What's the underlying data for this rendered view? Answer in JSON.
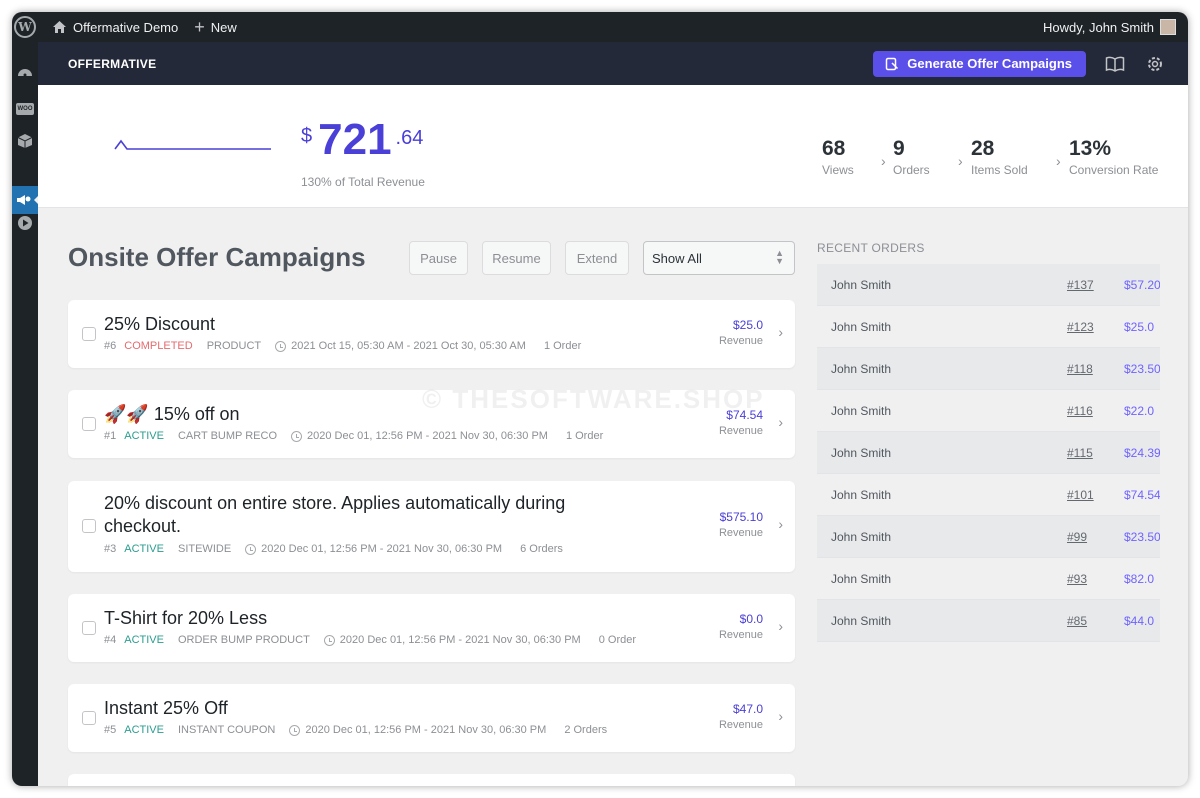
{
  "adminbar": {
    "site_name": "Offermative Demo",
    "new_label": "New",
    "greeting": "Howdy, John Smith"
  },
  "header": {
    "brand": "OFFERMATIVE",
    "generate_label": "Generate Offer Campaigns"
  },
  "stats": {
    "currency": "$",
    "revenue_int": "721",
    "revenue_dec": ".64",
    "revenue_note": "130% of Total Revenue",
    "metrics": [
      {
        "value": "68",
        "label": "Views"
      },
      {
        "value": "9",
        "label": "Orders"
      },
      {
        "value": "28",
        "label": "Items Sold"
      },
      {
        "value": "13%",
        "label": "Conversion Rate"
      }
    ]
  },
  "campaigns": {
    "title": "Onsite Offer Campaigns",
    "actions": {
      "pause": "Pause",
      "resume": "Resume",
      "extend": "Extend"
    },
    "filter": "Show All",
    "items": [
      {
        "title": "25% Discount",
        "id": "#6",
        "status": "COMPLETED",
        "type": "PRODUCT",
        "dates": "2021 Oct 15, 05:30 AM - 2021 Oct 30, 05:30 AM",
        "orders": "1 Order",
        "revenue": "$25.0",
        "revenue_label": "Revenue"
      },
      {
        "title": "🚀🚀 15% off on",
        "id": "#1",
        "status": "ACTIVE",
        "type": "CART BUMP RECO",
        "dates": "2020 Dec 01, 12:56 PM - 2021 Nov 30, 06:30 PM",
        "orders": "1 Order",
        "revenue": "$74.54",
        "revenue_label": "Revenue"
      },
      {
        "title": "20% discount on entire store. Applies automatically during checkout.",
        "id": "#3",
        "status": "ACTIVE",
        "type": "SITEWIDE",
        "dates": "2020 Dec 01, 12:56 PM - 2021 Nov 30, 06:30 PM",
        "orders": "6 Orders",
        "revenue": "$575.10",
        "revenue_label": "Revenue"
      },
      {
        "title": "T-Shirt for 20% Less",
        "id": "#4",
        "status": "ACTIVE",
        "type": "ORDER BUMP PRODUCT",
        "dates": "2020 Dec 01, 12:56 PM - 2021 Nov 30, 06:30 PM",
        "orders": "0 Order",
        "revenue": "$0.0",
        "revenue_label": "Revenue"
      },
      {
        "title": "Instant 25% Off",
        "id": "#5",
        "status": "ACTIVE",
        "type": "INSTANT COUPON",
        "dates": "2020 Dec 01, 12:56 PM - 2021 Nov 30, 06:30 PM",
        "orders": "2 Orders",
        "revenue": "$47.0",
        "revenue_label": "Revenue"
      }
    ]
  },
  "recent_orders": {
    "title": "RECENT ORDERS",
    "rows": [
      {
        "name": "John Smith",
        "id": "#137",
        "amount": "$57.20"
      },
      {
        "name": "John Smith",
        "id": "#123",
        "amount": "$25.0"
      },
      {
        "name": "John Smith",
        "id": "#118",
        "amount": "$23.50"
      },
      {
        "name": "John Smith",
        "id": "#116",
        "amount": "$22.0"
      },
      {
        "name": "John Smith",
        "id": "#115",
        "amount": "$24.39"
      },
      {
        "name": "John Smith",
        "id": "#101",
        "amount": "$74.54"
      },
      {
        "name": "John Smith",
        "id": "#99",
        "amount": "$23.50"
      },
      {
        "name": "John Smith",
        "id": "#93",
        "amount": "$82.0"
      },
      {
        "name": "John Smith",
        "id": "#85",
        "amount": "$44.0"
      }
    ]
  },
  "watermark": "© THESOFTWARE.SHOP",
  "colors": {
    "accent": "#5b4fe9",
    "active": "#2a9d8f",
    "completed": "#e56b6f",
    "adminbar": "#1d2327",
    "header": "#232939"
  }
}
